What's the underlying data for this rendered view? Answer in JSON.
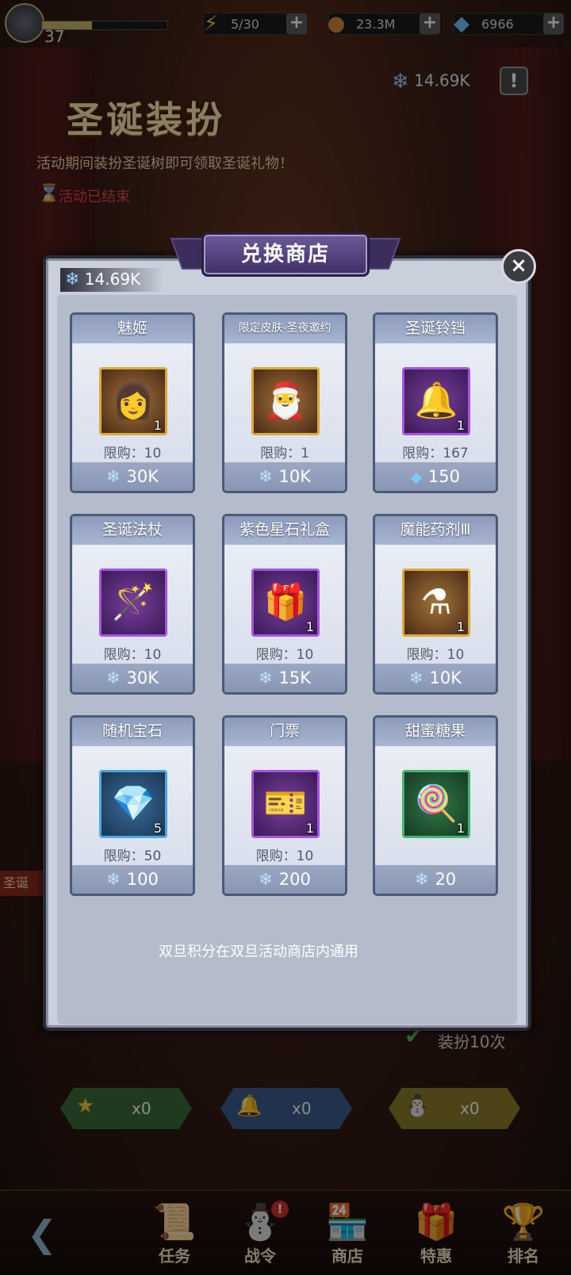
{
  "topbar": {
    "level": "37",
    "xp_fraction": 0.4,
    "stamina": "5/30",
    "gold": "23.3M",
    "diamonds": "6966",
    "plus": "+"
  },
  "event": {
    "title": "圣诞装扮",
    "description": "活动期间装扮圣诞树即可领取圣诞礼物！",
    "status": "活动已结束",
    "snowflakes": "14.69K",
    "info_label": "!"
  },
  "background": {
    "tip": "双旦积分在双旦活动商店内通用",
    "dress10_label": "装扮10次",
    "side_tab": "圣诞",
    "counters": [
      {
        "icon": "★",
        "value": "x0"
      },
      {
        "icon": "🔔",
        "value": "x0"
      },
      {
        "icon": "⛄",
        "value": "x0"
      }
    ]
  },
  "shop": {
    "title": "兑换商店",
    "close_label": "×",
    "currency": "14.69K",
    "items": [
      {
        "name": "魅姬",
        "icon": "👩",
        "qty": "1",
        "limit": "限购：10",
        "price": "30K",
        "currency": "snowflake",
        "frame": "gold"
      },
      {
        "name": "限定皮肤-圣夜邀约",
        "icon": "🎅",
        "qty": "",
        "limit": "限购：1",
        "price": "10K",
        "currency": "snowflake",
        "frame": "gold"
      },
      {
        "name": "圣诞铃铛",
        "icon": "🔔",
        "qty": "1",
        "limit": "限购：167",
        "price": "150",
        "currency": "diamond",
        "frame": "purple"
      },
      {
        "name": "圣诞法杖",
        "icon": "🪄",
        "qty": "",
        "limit": "限购：10",
        "price": "30K",
        "currency": "snowflake",
        "frame": "purple"
      },
      {
        "name": "紫色星石礼盒",
        "icon": "🎁",
        "qty": "1",
        "limit": "限购：10",
        "price": "15K",
        "currency": "snowflake",
        "frame": "purple"
      },
      {
        "name": "魔能药剂Ⅲ",
        "icon": "⚗",
        "qty": "1",
        "limit": "限购：10",
        "price": "10K",
        "currency": "snowflake",
        "frame": "gold"
      },
      {
        "name": "随机宝石",
        "icon": "💎",
        "qty": "5",
        "limit": "限购：50",
        "price": "100",
        "currency": "snowflake",
        "frame": "blue"
      },
      {
        "name": "门票",
        "icon": "🎫",
        "qty": "1",
        "limit": "限购：10",
        "price": "200",
        "currency": "snowflake",
        "frame": "purple"
      },
      {
        "name": "甜蜜糖果",
        "icon": "🍭",
        "qty": "1",
        "limit": "",
        "price": "20",
        "currency": "snowflake",
        "frame": "green"
      }
    ]
  },
  "nav": {
    "items": [
      {
        "label": "任务",
        "icon": "📜",
        "badge": ""
      },
      {
        "label": "战令",
        "icon": "⛄",
        "badge": "!"
      },
      {
        "label": "商店",
        "icon": "🏪",
        "badge": ""
      },
      {
        "label": "特惠",
        "icon": "🎁",
        "badge": ""
      },
      {
        "label": "排名",
        "icon": "🏆",
        "badge": ""
      }
    ]
  }
}
